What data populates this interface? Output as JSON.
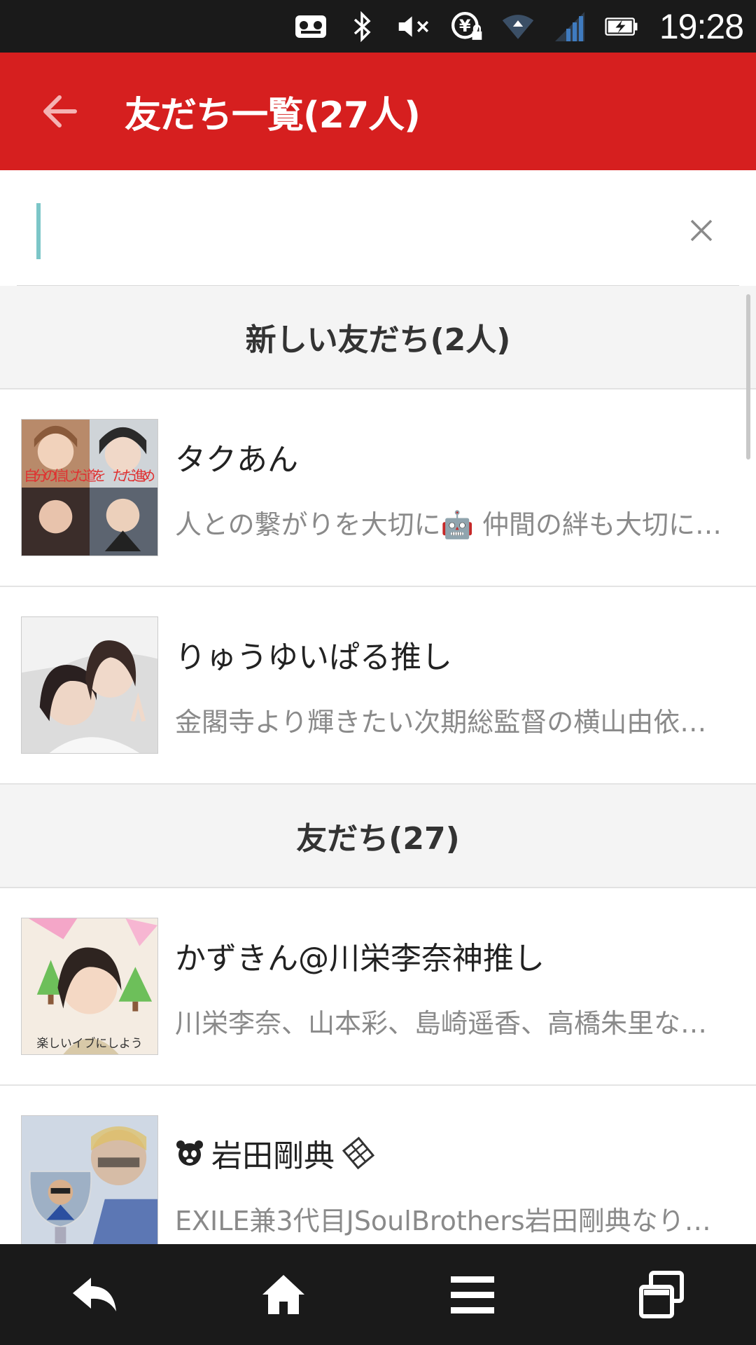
{
  "status_bar": {
    "time": "19:28"
  },
  "app_bar": {
    "title": "友だち一覧(27人)"
  },
  "search": {
    "value": "",
    "placeholder": ""
  },
  "sections": [
    {
      "title": "新しい友だち(2人)"
    },
    {
      "title": "友だち(27)"
    }
  ],
  "new_friends": [
    {
      "name": "タクあん",
      "status": "人との繋がりを大切に🤖 仲間の絆も大切に…"
    },
    {
      "name": "りゅうゆいぱる推し",
      "status": "金閣寺より輝きたい次期総監督の横山由依…"
    }
  ],
  "friends": [
    {
      "name": "かずきん@川栄李奈神推し",
      "status": "川栄李奈、山本彩、島崎遥香、高橋朱里な…"
    },
    {
      "name": "岩田剛典",
      "status": "EXILE兼3代目JSoulBrothers岩田剛典なりき…"
    }
  ],
  "avatar_images": [
    {
      "overlay": "自分の信じた道を　ただ進め"
    },
    {
      "overlay": ""
    },
    {
      "overlay": "楽しいイブにしよう"
    },
    {
      "overlay": ""
    }
  ],
  "colors": {
    "accent": "#d61f1f",
    "bars": "#1a1a1a"
  }
}
